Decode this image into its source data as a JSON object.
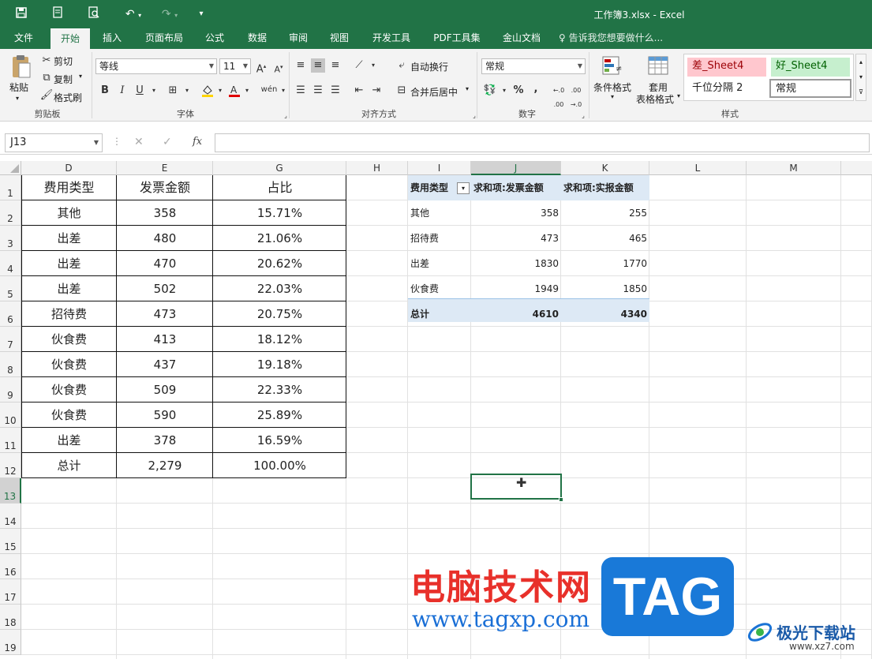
{
  "title": "工作簿3.xlsx - Excel",
  "qat": {
    "save_icon": "save-icon",
    "touch_icon": "touch-mode-icon",
    "preview_icon": "print-preview-icon",
    "undo_icon": "undo-icon",
    "redo_icon": "redo-icon",
    "customize_icon": "customize-qat-icon"
  },
  "tabs": [
    "文件",
    "开始",
    "插入",
    "页面布局",
    "公式",
    "数据",
    "审阅",
    "视图",
    "开发工具",
    "PDF工具集",
    "金山文档"
  ],
  "active_tab": "开始",
  "tell_me": "告诉我您想要做什么...",
  "ribbon": {
    "clipboard": {
      "paste": "粘贴",
      "cut": "剪切",
      "copy": "复制",
      "format_painter": "格式刷",
      "label": "剪贴板"
    },
    "font": {
      "font_name": "等线",
      "font_size": "11",
      "bold": "B",
      "italic": "I",
      "underline": "U",
      "label": "字体"
    },
    "alignment": {
      "wrap": "自动换行",
      "merge": "合并后居中",
      "label": "对齐方式"
    },
    "number": {
      "format": "常规",
      "percent": "%",
      "comma": ",",
      "label": "数字"
    },
    "styles": {
      "conditional": "条件格式",
      "table_format_1": "套用",
      "table_format_2": "表格格式",
      "bad": "差_Sheet4",
      "good": "好_Sheet4",
      "thousands": "千位分隔 2",
      "normal": "常规",
      "label": "样式"
    }
  },
  "formula_bar": {
    "name_box": "J13",
    "cancel": "✕",
    "enter": "✓",
    "fx": "fx",
    "content": ""
  },
  "columns": [
    "D",
    "E",
    "G",
    "H",
    "I",
    "J",
    "K",
    "L",
    "M"
  ],
  "rows": [
    "1",
    "2",
    "3",
    "4",
    "5",
    "6",
    "7",
    "8",
    "9",
    "10",
    "11",
    "12",
    "13",
    "14",
    "15",
    "16",
    "17",
    "18",
    "19"
  ],
  "table": {
    "headers": [
      "费用类型",
      "发票金额",
      "占比"
    ],
    "rows": [
      [
        "其他",
        "358",
        "15.71%"
      ],
      [
        "出差",
        "480",
        "21.06%"
      ],
      [
        "出差",
        "470",
        "20.62%"
      ],
      [
        "出差",
        "502",
        "22.03%"
      ],
      [
        "招待费",
        "473",
        "20.75%"
      ],
      [
        "伙食费",
        "413",
        "18.12%"
      ],
      [
        "伙食费",
        "437",
        "19.18%"
      ],
      [
        "伙食费",
        "509",
        "22.33%"
      ],
      [
        "伙食费",
        "590",
        "25.89%"
      ],
      [
        "出差",
        "378",
        "16.59%"
      ],
      [
        "总计",
        "2,279",
        "100.00%"
      ]
    ]
  },
  "pivot": {
    "headers": [
      "费用类型",
      "求和项:发票金额",
      "求和项:实报金额"
    ],
    "rows": [
      [
        "其他",
        "358",
        "255"
      ],
      [
        "招待费",
        "473",
        "465"
      ],
      [
        "出差",
        "1830",
        "1770"
      ],
      [
        "伙食费",
        "1949",
        "1850"
      ]
    ],
    "total": [
      "总计",
      "4610",
      "4340"
    ]
  },
  "watermark": {
    "site": "电脑技术网",
    "url": "www.tagxp.com",
    "tag": "TAG",
    "brand": "极光下载站",
    "brand_url": "www.xz7.com"
  },
  "colors": {
    "excel_green": "#217346",
    "pivot_header": "#dde9f5",
    "pivot_total": "#dde9f5",
    "bad_style": "#ffc7ce",
    "good_style": "#c6efce"
  }
}
